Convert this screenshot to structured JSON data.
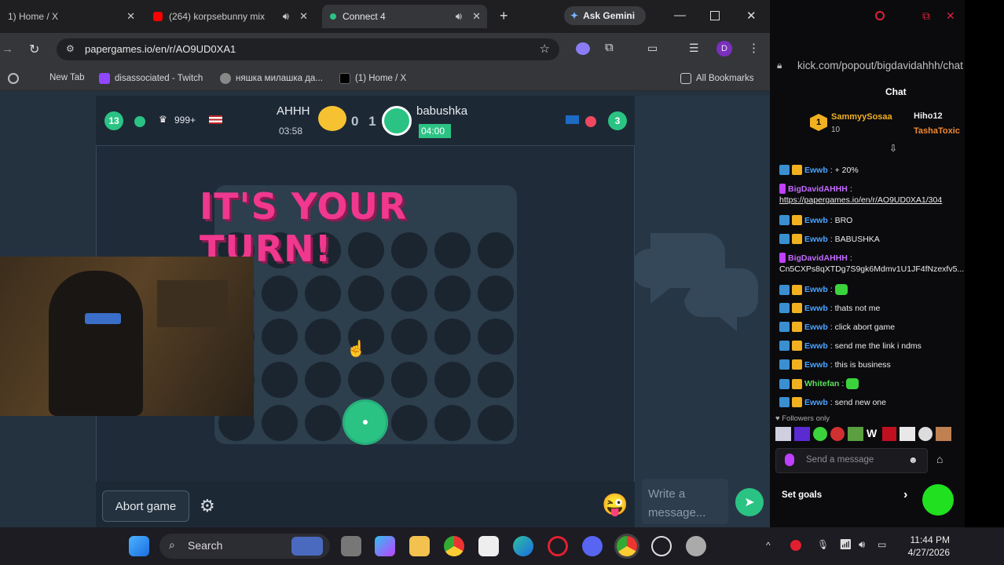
{
  "browser": {
    "tabs": [
      {
        "title": "1) Home / X",
        "favicon": "x-logo-icon"
      },
      {
        "title": "(264) korpsebunny mix",
        "favicon": "youtube-icon"
      },
      {
        "title": "Connect 4",
        "favicon": "papergames-icon"
      }
    ],
    "ask_gemini": "Ask Gemini",
    "url": "papergames.io/en/r/AO9UD0XA1",
    "profile_initial": "D",
    "bookmarks": [
      "New Tab",
      "disassociated - Twitch",
      "няшка милашка да...",
      "(1) Home / X"
    ],
    "all_bookmarks": "All Bookmarks"
  },
  "game": {
    "player1": {
      "level": "13",
      "trophies": "999+",
      "name": "AHHH",
      "timer": "03:58"
    },
    "score": "0 1",
    "player2": {
      "name": "babushka",
      "timer": "04:00",
      "level": "3"
    },
    "turn_banner": "IT'S YOUR TURN!",
    "abort_label": "Abort game",
    "write_placeholder": "Write a message...",
    "emoji": "😜"
  },
  "kick": {
    "url": "kick.com/popout/bigdavidahhh/chat",
    "chat_title": "Chat",
    "top_gifters": [
      {
        "name": "SammyySosaa",
        "count": "10",
        "rank": "1"
      },
      {
        "name": "Hiho12"
      },
      {
        "name": "TashaToxic"
      }
    ],
    "messages": [
      {
        "user": "Ewwb",
        "text": ": + 20%",
        "style": "u"
      },
      {
        "user": "BigDavidAHHH",
        "text": ":",
        "style": "p"
      },
      {
        "user": "",
        "text": "https://papergames.io/en/r/AO9UD0XA1/304",
        "style": "link"
      },
      {
        "user": "Ewwb",
        "text": ": BRO",
        "style": "u"
      },
      {
        "user": "Ewwb",
        "text": ": BABUSHKA",
        "style": "u"
      },
      {
        "user": "BigDavidAHHH",
        "text": ":",
        "style": "p"
      },
      {
        "user": "",
        "text": "Cn5CXPs8qXTDg7S9gk6Mdmv1U1JF4fNzexfv5...",
        "style": "plain"
      },
      {
        "user": "Ewwb",
        "text": ":",
        "style": "u"
      },
      {
        "user": "Ewwb",
        "text": ": thats not me",
        "style": "u"
      },
      {
        "user": "Ewwb",
        "text": ": click abort game",
        "style": "u"
      },
      {
        "user": "Ewwb",
        "text": ": send me the link i ndms",
        "style": "u"
      },
      {
        "user": "Ewwb",
        "text": ": this is business",
        "style": "u"
      },
      {
        "user": "Whitefan",
        "text": ":",
        "style": "g"
      },
      {
        "user": "Ewwb",
        "text": ": send new one",
        "style": "u"
      }
    ],
    "followers_only": "Followers only",
    "send_placeholder": "Send a message",
    "set_goals": "Set goals"
  },
  "taskbar": {
    "search_label": "Search",
    "time": "11:44 PM",
    "date": "4/27/2026"
  },
  "colors": {
    "board_bg": "#1f2b38",
    "accent_green": "#2bc384",
    "turn_pink": "#f0388f",
    "kick_green": "#20e020"
  }
}
